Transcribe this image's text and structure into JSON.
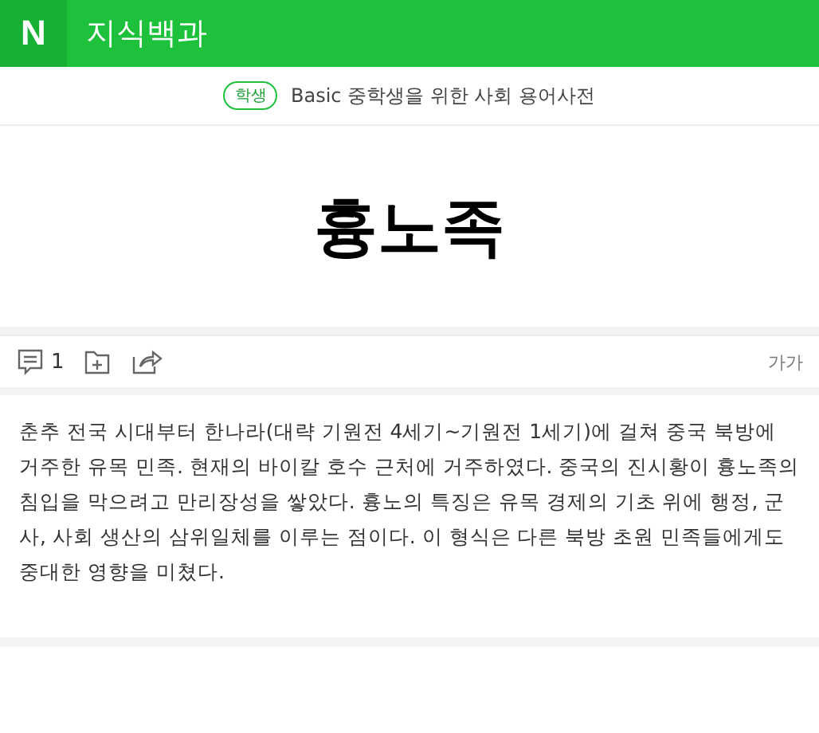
{
  "header": {
    "logo": "N",
    "title": "지식백과"
  },
  "source": {
    "badge": "학생",
    "name": "Basic 중학생을 위한 사회 용어사전"
  },
  "entry": {
    "title": "흉노족"
  },
  "toolbar": {
    "comment_count": "1",
    "font_size_button": "가가"
  },
  "body": "춘추 전국 시대부터 한나라(대략 기원전 4세기~기원전 1세기)에 걸쳐 중국 북방에 거주한 유목 민족. 현재의 바이칼 호수 근처에 거주하였다. 중국의 진시황이 흉노족의 침입을 막으려고 만리장성을 쌓았다. 흉노의 특징은 유목 경제의 기초 위에 행정, 군사, 사회 생산의 삼위일체를 이루는 점이다. 이 형식은 다른 북방 초원 민족들에게도 중대한 영향을 미쳤다."
}
